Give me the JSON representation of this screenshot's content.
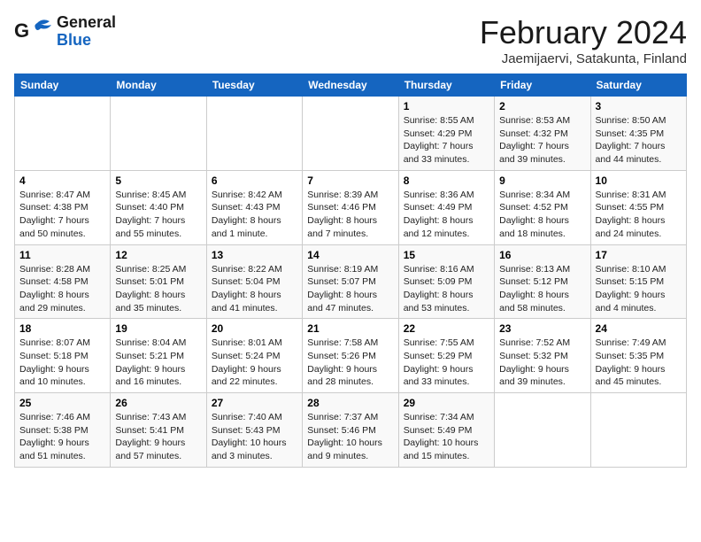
{
  "header": {
    "logo_line1": "General",
    "logo_line2": "Blue",
    "title": "February 2024",
    "subtitle": "Jaemijaervi, Satakunta, Finland"
  },
  "days_of_week": [
    "Sunday",
    "Monday",
    "Tuesday",
    "Wednesday",
    "Thursday",
    "Friday",
    "Saturday"
  ],
  "weeks": [
    [
      {
        "day": "",
        "info": ""
      },
      {
        "day": "",
        "info": ""
      },
      {
        "day": "",
        "info": ""
      },
      {
        "day": "",
        "info": ""
      },
      {
        "day": "1",
        "info": "Sunrise: 8:55 AM\nSunset: 4:29 PM\nDaylight: 7 hours\nand 33 minutes."
      },
      {
        "day": "2",
        "info": "Sunrise: 8:53 AM\nSunset: 4:32 PM\nDaylight: 7 hours\nand 39 minutes."
      },
      {
        "day": "3",
        "info": "Sunrise: 8:50 AM\nSunset: 4:35 PM\nDaylight: 7 hours\nand 44 minutes."
      }
    ],
    [
      {
        "day": "4",
        "info": "Sunrise: 8:47 AM\nSunset: 4:38 PM\nDaylight: 7 hours\nand 50 minutes."
      },
      {
        "day": "5",
        "info": "Sunrise: 8:45 AM\nSunset: 4:40 PM\nDaylight: 7 hours\nand 55 minutes."
      },
      {
        "day": "6",
        "info": "Sunrise: 8:42 AM\nSunset: 4:43 PM\nDaylight: 8 hours\nand 1 minute."
      },
      {
        "day": "7",
        "info": "Sunrise: 8:39 AM\nSunset: 4:46 PM\nDaylight: 8 hours\nand 7 minutes."
      },
      {
        "day": "8",
        "info": "Sunrise: 8:36 AM\nSunset: 4:49 PM\nDaylight: 8 hours\nand 12 minutes."
      },
      {
        "day": "9",
        "info": "Sunrise: 8:34 AM\nSunset: 4:52 PM\nDaylight: 8 hours\nand 18 minutes."
      },
      {
        "day": "10",
        "info": "Sunrise: 8:31 AM\nSunset: 4:55 PM\nDaylight: 8 hours\nand 24 minutes."
      }
    ],
    [
      {
        "day": "11",
        "info": "Sunrise: 8:28 AM\nSunset: 4:58 PM\nDaylight: 8 hours\nand 29 minutes."
      },
      {
        "day": "12",
        "info": "Sunrise: 8:25 AM\nSunset: 5:01 PM\nDaylight: 8 hours\nand 35 minutes."
      },
      {
        "day": "13",
        "info": "Sunrise: 8:22 AM\nSunset: 5:04 PM\nDaylight: 8 hours\nand 41 minutes."
      },
      {
        "day": "14",
        "info": "Sunrise: 8:19 AM\nSunset: 5:07 PM\nDaylight: 8 hours\nand 47 minutes."
      },
      {
        "day": "15",
        "info": "Sunrise: 8:16 AM\nSunset: 5:09 PM\nDaylight: 8 hours\nand 53 minutes."
      },
      {
        "day": "16",
        "info": "Sunrise: 8:13 AM\nSunset: 5:12 PM\nDaylight: 8 hours\nand 58 minutes."
      },
      {
        "day": "17",
        "info": "Sunrise: 8:10 AM\nSunset: 5:15 PM\nDaylight: 9 hours\nand 4 minutes."
      }
    ],
    [
      {
        "day": "18",
        "info": "Sunrise: 8:07 AM\nSunset: 5:18 PM\nDaylight: 9 hours\nand 10 minutes."
      },
      {
        "day": "19",
        "info": "Sunrise: 8:04 AM\nSunset: 5:21 PM\nDaylight: 9 hours\nand 16 minutes."
      },
      {
        "day": "20",
        "info": "Sunrise: 8:01 AM\nSunset: 5:24 PM\nDaylight: 9 hours\nand 22 minutes."
      },
      {
        "day": "21",
        "info": "Sunrise: 7:58 AM\nSunset: 5:26 PM\nDaylight: 9 hours\nand 28 minutes."
      },
      {
        "day": "22",
        "info": "Sunrise: 7:55 AM\nSunset: 5:29 PM\nDaylight: 9 hours\nand 33 minutes."
      },
      {
        "day": "23",
        "info": "Sunrise: 7:52 AM\nSunset: 5:32 PM\nDaylight: 9 hours\nand 39 minutes."
      },
      {
        "day": "24",
        "info": "Sunrise: 7:49 AM\nSunset: 5:35 PM\nDaylight: 9 hours\nand 45 minutes."
      }
    ],
    [
      {
        "day": "25",
        "info": "Sunrise: 7:46 AM\nSunset: 5:38 PM\nDaylight: 9 hours\nand 51 minutes."
      },
      {
        "day": "26",
        "info": "Sunrise: 7:43 AM\nSunset: 5:41 PM\nDaylight: 9 hours\nand 57 minutes."
      },
      {
        "day": "27",
        "info": "Sunrise: 7:40 AM\nSunset: 5:43 PM\nDaylight: 10 hours\nand 3 minutes."
      },
      {
        "day": "28",
        "info": "Sunrise: 7:37 AM\nSunset: 5:46 PM\nDaylight: 10 hours\nand 9 minutes."
      },
      {
        "day": "29",
        "info": "Sunrise: 7:34 AM\nSunset: 5:49 PM\nDaylight: 10 hours\nand 15 minutes."
      },
      {
        "day": "",
        "info": ""
      },
      {
        "day": "",
        "info": ""
      }
    ]
  ]
}
